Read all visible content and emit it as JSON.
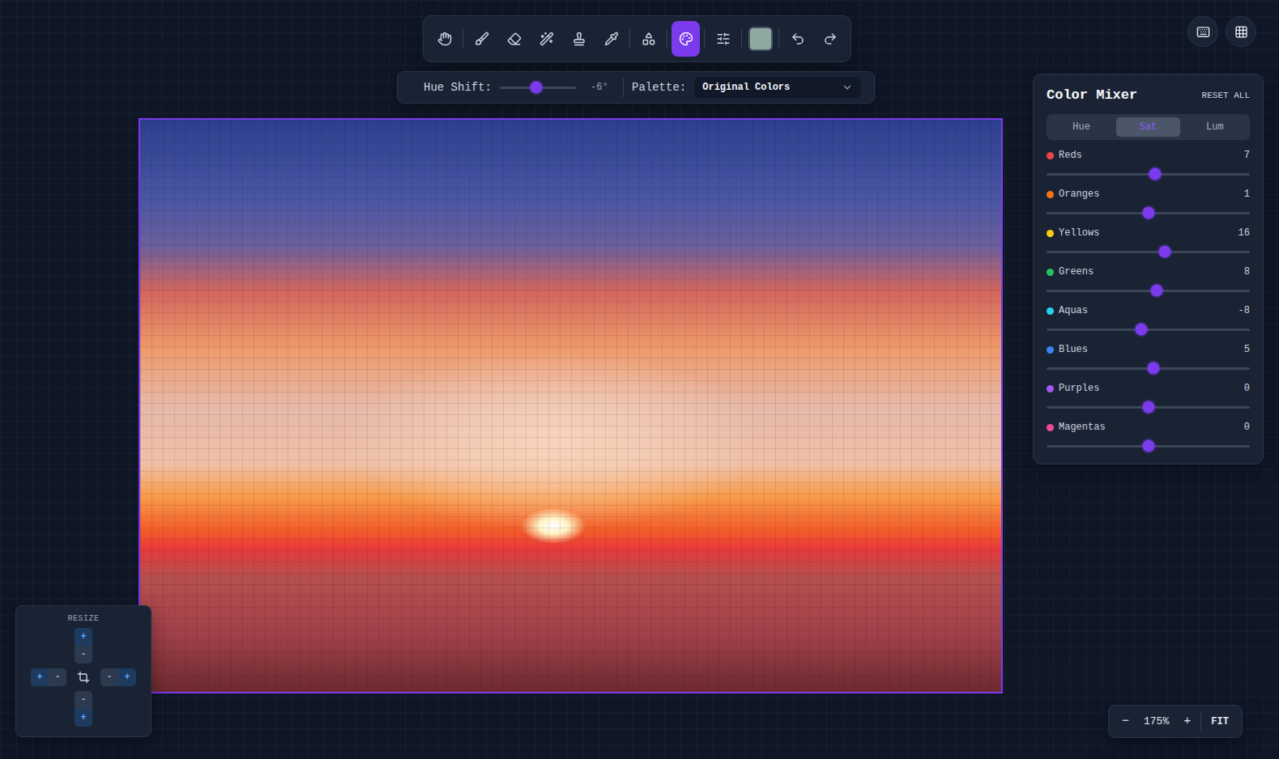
{
  "toolbar": {
    "tools": [
      {
        "selected": false
      },
      {
        "selected": false
      },
      {
        "selected": false
      },
      {
        "selected": false
      },
      {
        "selected": false
      },
      {
        "selected": false
      },
      {
        "selected": false
      },
      {
        "selected": true
      },
      {
        "selected": false
      }
    ],
    "current_color": "#8fa8a0"
  },
  "adjust_bar": {
    "hue_shift": {
      "label": "Hue Shift:",
      "level": 0.48,
      "reading": "-6°"
    },
    "palette": {
      "label": "Palette:",
      "value": "Original Colors"
    }
  },
  "color_mixer": {
    "title": "Color Mixer",
    "reset": "RESET ALL",
    "tabs": [
      {
        "label": "Hue",
        "selected": false
      },
      {
        "label": "Sat",
        "selected": true
      },
      {
        "label": "Lum",
        "selected": false
      }
    ],
    "channels": [
      {
        "name": "Reds",
        "reading": "7",
        "level": 0.534,
        "color": "#ef4444"
      },
      {
        "name": "Oranges",
        "reading": "1",
        "level": 0.503,
        "color": "#f97316"
      },
      {
        "name": "Yellows",
        "reading": "16",
        "level": 0.58,
        "color": "#facc15"
      },
      {
        "name": "Greens",
        "reading": "8",
        "level": 0.54,
        "color": "#22c55e"
      },
      {
        "name": "Aquas",
        "reading": "-8",
        "level": 0.465,
        "color": "#22d3ee"
      },
      {
        "name": "Blues",
        "reading": "5",
        "level": 0.526,
        "color": "#3b82f6"
      },
      {
        "name": "Purples",
        "reading": "0",
        "level": 0.5,
        "color": "#a855f7"
      },
      {
        "name": "Magentas",
        "reading": "0",
        "level": 0.5,
        "color": "#ec4899"
      }
    ]
  },
  "resize": {
    "title": "RESIZE",
    "top": [
      "+",
      "-"
    ],
    "left": [
      "+",
      "-"
    ],
    "right": [
      "-",
      "+"
    ],
    "bottom": [
      "-",
      "+"
    ]
  },
  "zoom": {
    "minus": "−",
    "level": "175%",
    "plus": "+",
    "fit": "FIT"
  }
}
